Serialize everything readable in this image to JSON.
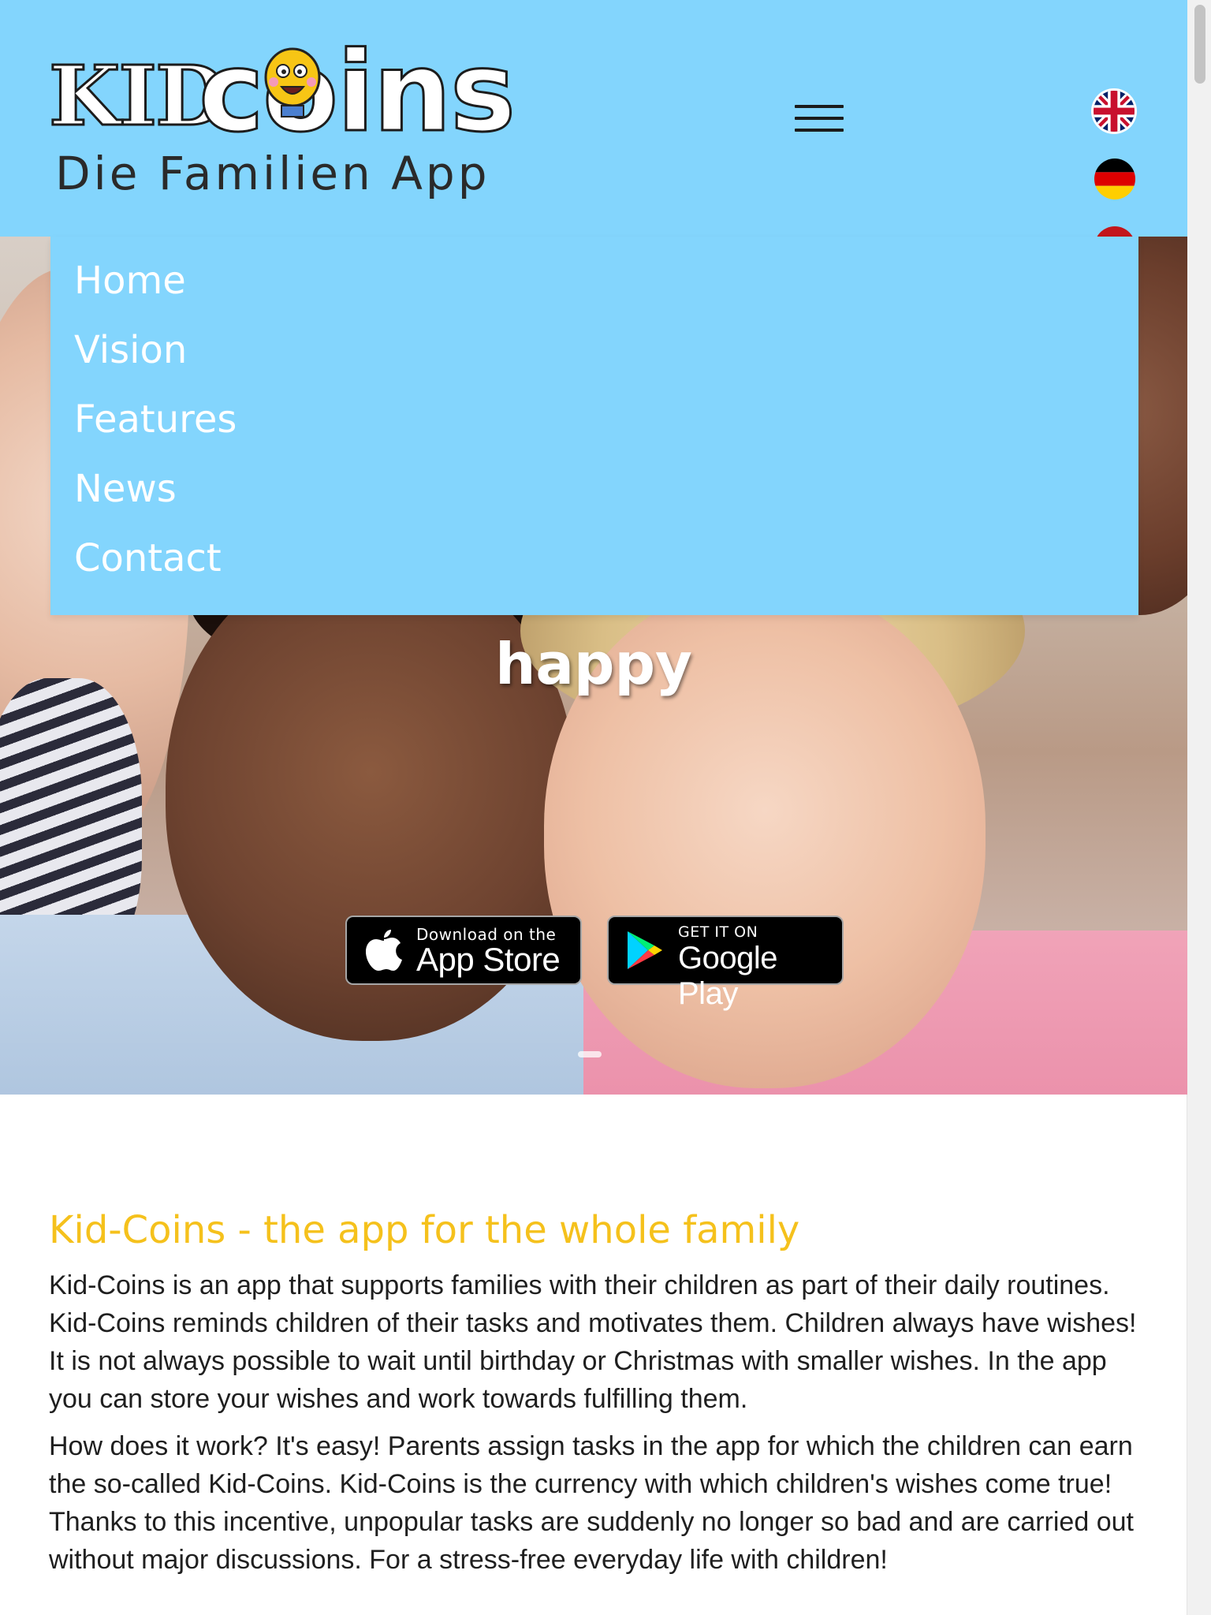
{
  "brand": {
    "logo_word1": "KID",
    "logo_word2": "coins",
    "tagline": "Die Familien App"
  },
  "languages": [
    {
      "code": "en",
      "icon": "uk-flag-icon"
    },
    {
      "code": "de",
      "icon": "german-flag-icon"
    },
    {
      "code": "other",
      "icon": "flag-icon"
    }
  ],
  "menu": {
    "items": [
      {
        "label": "Home"
      },
      {
        "label": "Vision"
      },
      {
        "label": "Features"
      },
      {
        "label": "News"
      },
      {
        "label": "Contact"
      }
    ]
  },
  "hero": {
    "title": "happy",
    "app_store": {
      "small": "Download on the",
      "big": "App Store"
    },
    "google_play": {
      "small": "GET IT ON",
      "big": "Google Play"
    }
  },
  "content": {
    "heading": "Kid-Coins - the app for the whole family",
    "paragraph1": "Kid-Coins is an app that supports families with their children as part of their daily routines. Kid-Coins reminds children of their tasks and motivates them. Children always have wishes! It is not always possible to wait until birthday or Christmas with smaller wishes. In the app you can store your wishes and work towards fulfilling them.",
    "paragraph2": "How does it work? It's easy! Parents assign tasks in the app for which the children can earn the so-called Kid-Coins. Kid-Coins is the currency with which children's wishes come true! Thanks to this incentive, unpopular tasks are suddenly no longer so bad and are carried out without major discussions. For a stress-free everyday life with children!"
  },
  "colors": {
    "header_bg": "#83d5fd",
    "heading": "#f5c11c",
    "text": "#1f1f1f"
  }
}
